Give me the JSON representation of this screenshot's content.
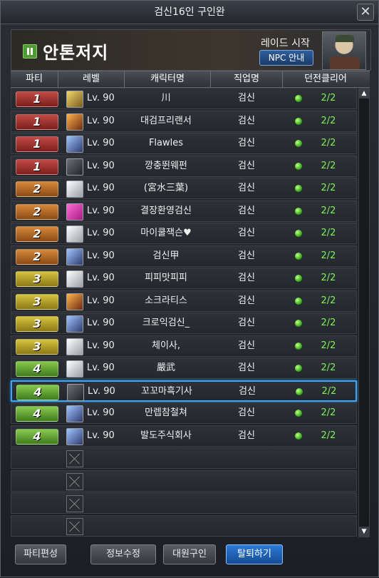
{
  "window": {
    "title": "검신16인 구인완"
  },
  "header": {
    "group_name": "안톤저지",
    "raid_start": "레이드 시작",
    "npc_button": "NPC 안내"
  },
  "table": {
    "columns": [
      "파티",
      "레벨",
      "캐릭터명",
      "직업명",
      "던전클리어"
    ],
    "rows": [
      {
        "party": "1",
        "level": "Lv. 90",
        "name": "川",
        "job": "검신",
        "clear": "2/2"
      },
      {
        "party": "1",
        "level": "Lv. 90",
        "name": "대검프리랜서",
        "job": "검신",
        "clear": "2/2"
      },
      {
        "party": "1",
        "level": "Lv. 90",
        "name": "Flawles",
        "job": "검신",
        "clear": "2/2"
      },
      {
        "party": "1",
        "level": "Lv. 90",
        "name": "깡충뛴웨펀",
        "job": "검신",
        "clear": "2/2"
      },
      {
        "party": "2",
        "level": "Lv. 90",
        "name": "(宮水三葉)",
        "job": "검신",
        "clear": "2/2"
      },
      {
        "party": "2",
        "level": "Lv. 90",
        "name": "결장환영검신",
        "job": "검신",
        "clear": "2/2"
      },
      {
        "party": "2",
        "level": "Lv. 90",
        "name": "마이쿨잭슨♥",
        "job": "검신",
        "clear": "2/2"
      },
      {
        "party": "2",
        "level": "Lv. 90",
        "name": "검신甲",
        "job": "검신",
        "clear": "2/2"
      },
      {
        "party": "3",
        "level": "Lv. 90",
        "name": "피피맛피피",
        "job": "검신",
        "clear": "2/2"
      },
      {
        "party": "3",
        "level": "Lv. 90",
        "name": "소크라티스",
        "job": "검신",
        "clear": "2/2"
      },
      {
        "party": "3",
        "level": "Lv. 90",
        "name": "크로익검신_",
        "job": "검신",
        "clear": "2/2"
      },
      {
        "party": "3",
        "level": "Lv. 90",
        "name": "체이사,",
        "job": "검신",
        "clear": "2/2"
      },
      {
        "party": "4",
        "level": "Lv. 90",
        "name": "嚴武",
        "job": "검신",
        "clear": "2/2"
      },
      {
        "party": "4",
        "level": "Lv. 90",
        "name": "꼬꼬마흑기사",
        "job": "검신",
        "clear": "2/2"
      },
      {
        "party": "4",
        "level": "Lv. 90",
        "name": "만렙참철쳐",
        "job": "검신",
        "clear": "2/2"
      },
      {
        "party": "4",
        "level": "Lv. 90",
        "name": "발도주식회사",
        "job": "검신",
        "clear": "2/2"
      }
    ],
    "selected_row": 13
  },
  "buttons": {
    "party_edit": "파티편성",
    "info_edit": "정보수정",
    "recruit": "대원구인",
    "leave": "탈퇴하기"
  },
  "colors": {
    "party1": "#a8322f",
    "party2": "#b56a28",
    "party3": "#b39f2a",
    "party4": "#62a336",
    "clear_text": "#7cf25a",
    "selected_border": "#3aa6ff"
  }
}
